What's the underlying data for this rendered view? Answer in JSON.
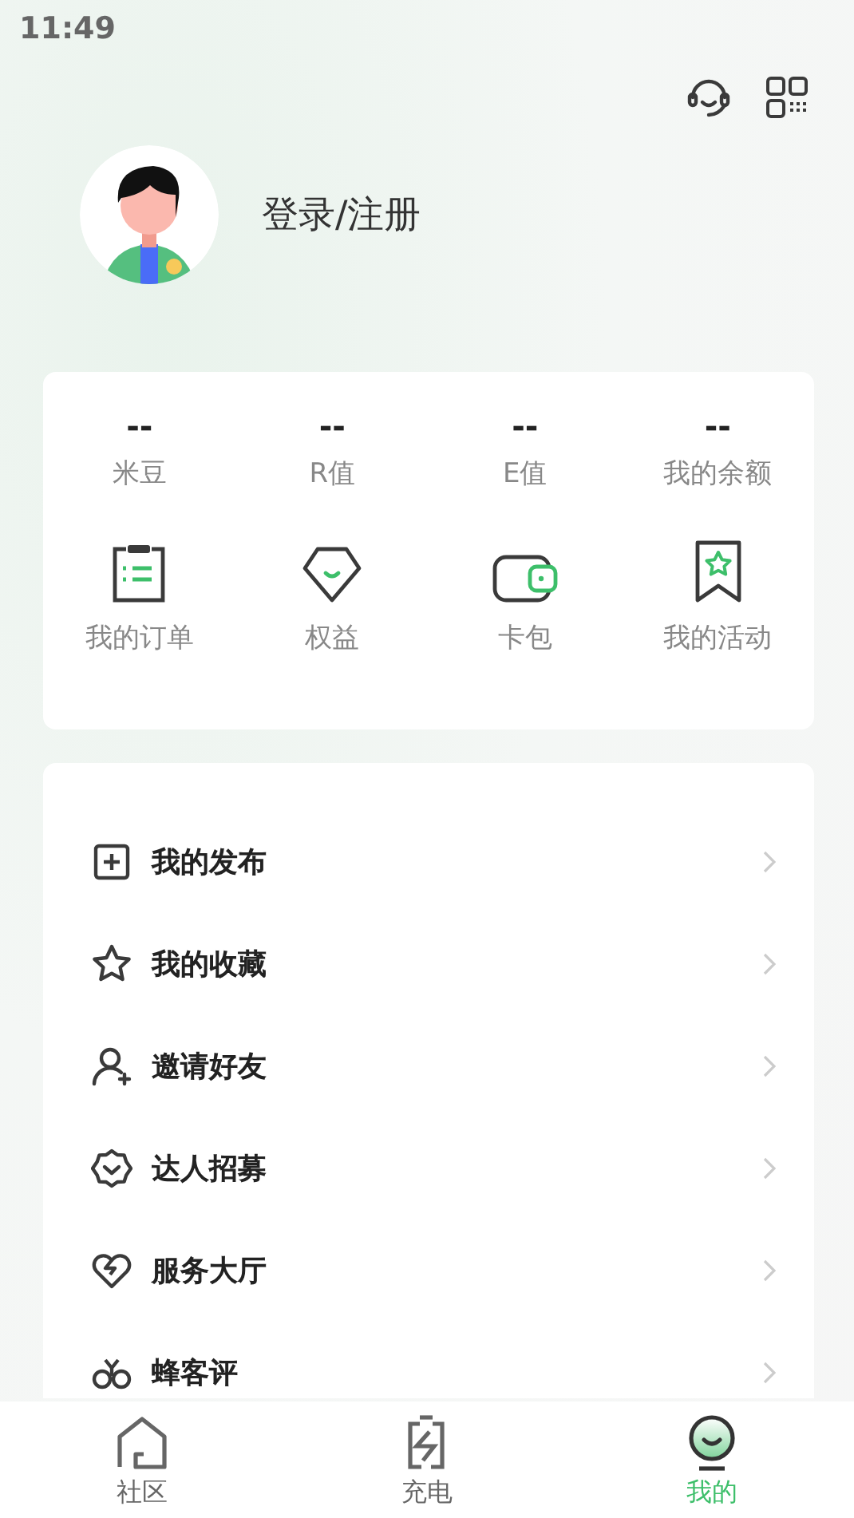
{
  "status_bar": {
    "time": "11:49"
  },
  "profile": {
    "login_label": "登录/注册"
  },
  "stats": [
    {
      "value": "--",
      "label": "米豆"
    },
    {
      "value": "--",
      "label": "R值"
    },
    {
      "value": "--",
      "label": "E值"
    },
    {
      "value": "--",
      "label": "我的余额"
    }
  ],
  "shortcuts": [
    {
      "kind": "order",
      "label": "我的订单"
    },
    {
      "kind": "rights",
      "label": "权益"
    },
    {
      "kind": "wallet",
      "label": "卡包"
    },
    {
      "kind": "activity",
      "label": "我的活动"
    }
  ],
  "menu": [
    {
      "kind": "post",
      "label": "我的发布"
    },
    {
      "kind": "favorite",
      "label": "我的收藏"
    },
    {
      "kind": "invite",
      "label": "邀请好友"
    },
    {
      "kind": "talent",
      "label": "达人招募"
    },
    {
      "kind": "service",
      "label": "服务大厅"
    },
    {
      "kind": "review",
      "label": "蜂客评"
    }
  ],
  "tabs": [
    {
      "kind": "community",
      "label": "社区",
      "selected": false
    },
    {
      "kind": "charge",
      "label": "充电",
      "selected": false
    },
    {
      "kind": "me",
      "label": "我的",
      "selected": true
    }
  ]
}
